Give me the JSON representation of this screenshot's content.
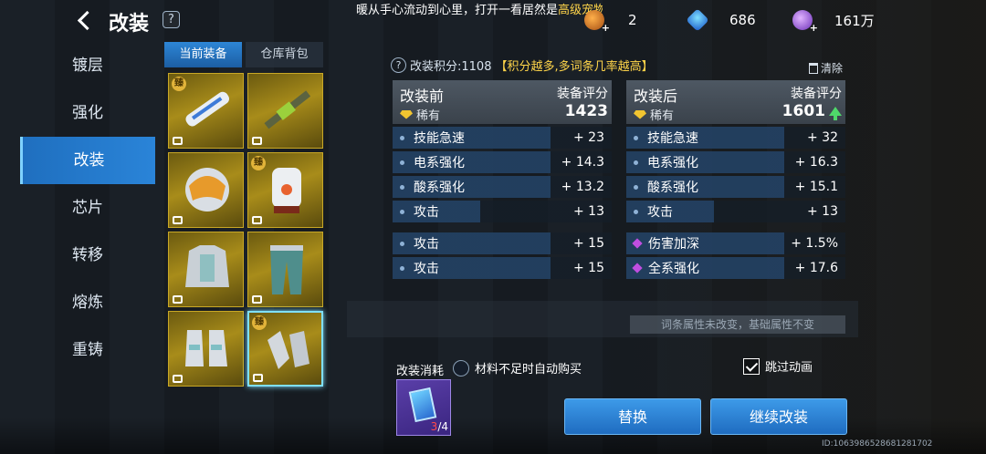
{
  "header": {
    "title": "改装",
    "help": "?",
    "marquee_prefix": "暖从手心流动到心里，打开一看居然是",
    "marquee_highlight": "高级宠物"
  },
  "resources": [
    {
      "icon": "ticket-icon",
      "value": "2"
    },
    {
      "icon": "crystal-icon",
      "value": "686"
    },
    {
      "icon": "orb-icon",
      "value": "161万"
    }
  ],
  "nav": {
    "items": [
      "镀层",
      "强化",
      "改装",
      "芯片",
      "转移",
      "熔炼",
      "重铸"
    ],
    "active_index": 2
  },
  "equip_tabs": [
    "当前装备",
    "仓库背包"
  ],
  "slot_tag": "臻",
  "score": {
    "label": "改装积分:1108",
    "hint": "【积分越多,多词条几率越高】",
    "clear": "清除"
  },
  "before": {
    "title": "改装前",
    "score_label": "装备评分",
    "rarity": "稀有",
    "score": "1423",
    "stats": [
      {
        "name": "技能急速",
        "value": "+ 23"
      },
      {
        "name": "电系强化",
        "value": "+ 14.3"
      },
      {
        "name": "酸系强化",
        "value": "+ 13.2"
      },
      {
        "name": "攻击",
        "value": "+ 13"
      }
    ],
    "extra": [
      {
        "name": "攻击",
        "value": "+ 15"
      },
      {
        "name": "攻击",
        "value": "+ 15"
      }
    ]
  },
  "after": {
    "title": "改装后",
    "score_label": "装备评分",
    "rarity": "稀有",
    "score": "1601",
    "stats": [
      {
        "name": "技能急速",
        "value": "+ 32"
      },
      {
        "name": "电系强化",
        "value": "+ 16.3"
      },
      {
        "name": "酸系强化",
        "value": "+ 15.1"
      },
      {
        "name": "攻击",
        "value": "+ 13"
      }
    ],
    "extra": [
      {
        "name": "伤害加深",
        "value": "+ 1.5%"
      },
      {
        "name": "全系强化",
        "value": "+ 17.6"
      }
    ]
  },
  "attr_note": "词条属性未改变，基础属性不变",
  "cost": {
    "label": "改装消耗",
    "auto_buy": "材料不足时自动购买",
    "material_have": "3",
    "material_need": "/4"
  },
  "skip_animation": "跳过动画",
  "buttons": {
    "replace": "替换",
    "continue": "继续改装"
  },
  "uid": "ID:1063986528681281702",
  "colors": {
    "accent": "#2a84d8",
    "highlight": "#ffd54a",
    "up": "#4fd86a",
    "epic": "#c04ee0"
  }
}
